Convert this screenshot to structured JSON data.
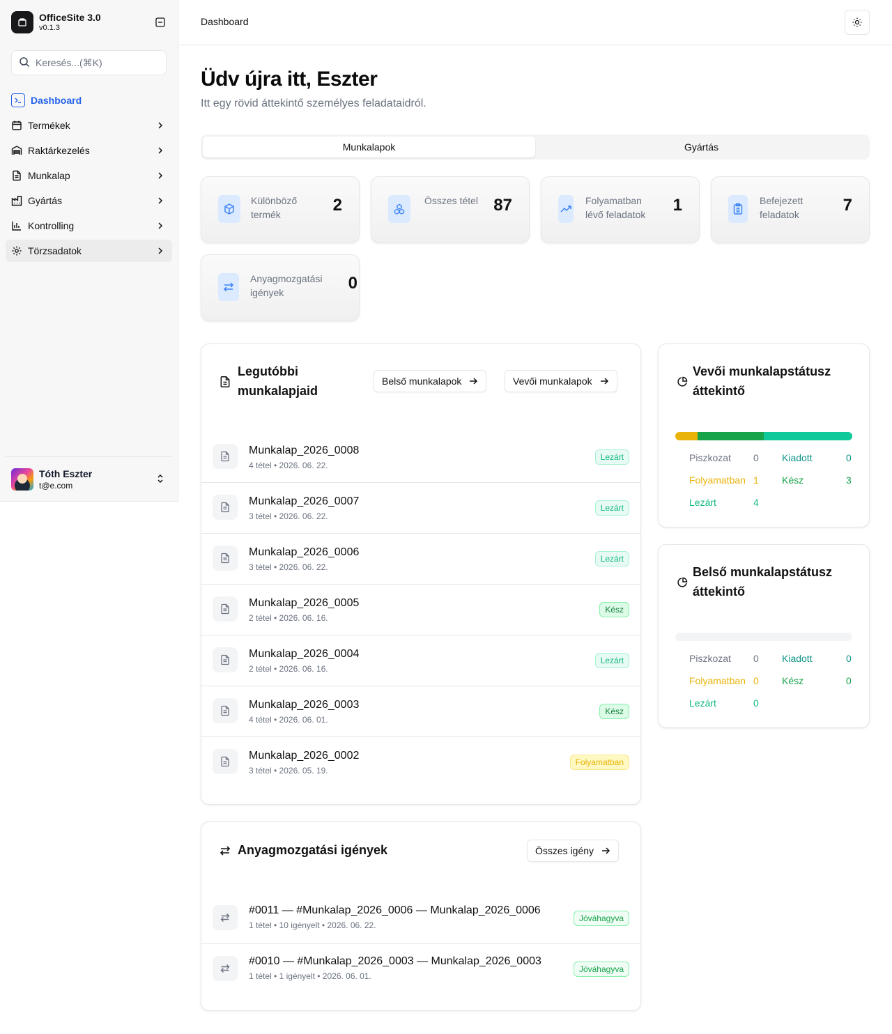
{
  "app": {
    "name": "OfficeSite 3.0",
    "version": "v0.1.3"
  },
  "search": {
    "placeholder": "Keresés...(⌘K)"
  },
  "nav": [
    {
      "label": "Dashboard",
      "icon": "terminal-square-icon"
    },
    {
      "label": "Termékek",
      "icon": "calendar-box-icon"
    },
    {
      "label": "Raktárkezelés",
      "icon": "warehouse-icon"
    },
    {
      "label": "Munkalap",
      "icon": "file-text-icon"
    },
    {
      "label": "Gyártás",
      "icon": "factory-icon"
    },
    {
      "label": "Kontrolling",
      "icon": "bar-chart-icon"
    },
    {
      "label": "Törzsadatok",
      "icon": "gear-icon"
    }
  ],
  "user": {
    "name": "Tóth Eszter",
    "email": "t@e.com"
  },
  "breadcrumb": "Dashboard",
  "page": {
    "title": "Üdv újra itt, Eszter",
    "subtitle": "Itt egy rövid áttekintő személyes feladataidról."
  },
  "tabs": [
    {
      "label": "Munkalapok"
    },
    {
      "label": "Gyártás"
    }
  ],
  "stats": [
    {
      "label": "Különböző termék",
      "value": "2",
      "icon": "box-icon"
    },
    {
      "label": "Összes tétel",
      "value": "87",
      "icon": "boxes-icon"
    },
    {
      "label": "Folyamatban lévő feladatok",
      "value": "1",
      "icon": "trending-up-icon"
    },
    {
      "label": "Befejezett feladatok",
      "value": "7",
      "icon": "clipboard-list-icon"
    },
    {
      "label": "Anyagmozgatási igények",
      "value": "0",
      "icon": "arrows-left-right-icon"
    }
  ],
  "recent": {
    "title": "Legutóbbi munkalapjaid",
    "btn_internal": "Belső munkalapok",
    "btn_customer": "Vevői munkalapok",
    "rows": [
      {
        "title": "Munkalap_2026_0008",
        "sub": "4 tétel • 2026. 06. 22.",
        "status": "Lezárt",
        "cls": "b-lezart"
      },
      {
        "title": "Munkalap_2026_0007",
        "sub": "3 tétel • 2026. 06. 22.",
        "status": "Lezárt",
        "cls": "b-lezart"
      },
      {
        "title": "Munkalap_2026_0006",
        "sub": "3 tétel • 2026. 06. 22.",
        "status": "Lezárt",
        "cls": "b-lezart"
      },
      {
        "title": "Munkalap_2026_0005",
        "sub": "2 tétel • 2026. 06. 16.",
        "status": "Kész",
        "cls": "b-kesz"
      },
      {
        "title": "Munkalap_2026_0004",
        "sub": "2 tétel • 2026. 06. 16.",
        "status": "Lezárt",
        "cls": "b-lezart"
      },
      {
        "title": "Munkalap_2026_0003",
        "sub": "4 tétel • 2026. 06. 01.",
        "status": "Kész",
        "cls": "b-kesz"
      },
      {
        "title": "Munkalap_2026_0002",
        "sub": "3 tétel • 2026. 05. 19.",
        "status": "Folyamatban",
        "cls": "b-folyamat"
      }
    ]
  },
  "moves": {
    "title": "Anyagmozgatási igények",
    "btn_all": "Összes igény",
    "rows": [
      {
        "title": "#0011 — #Munkalap_2026_0006 — Munkalap_2026_0006",
        "sub": "1 tétel • 10 igényelt • 2026. 06. 22.",
        "status": "Jóváhagyva"
      },
      {
        "title": "#0010 — #Munkalap_2026_0003 — Munkalap_2026_0003",
        "sub": "1 tétel • 1 igényelt • 2026. 06. 01.",
        "status": "Jóváhagyva"
      }
    ]
  },
  "status_colors": {
    "Piszkozat": "#6b7280",
    "Kiadott": "#0d9488",
    "Folyamatban": "#eab308",
    "Kész": "#16a34a",
    "Lezárt": "#10b981"
  },
  "customer_status": {
    "title": "Vevői munkalapstátusz áttekintő",
    "counts": {
      "Piszkozat": "0",
      "Kiadott": "0",
      "Folyamatban": "1",
      "Kész": "3",
      "Lezárt": "4"
    }
  },
  "internal_status": {
    "title": "Belső munkalapstátusz áttekintő",
    "counts": {
      "Piszkozat": "0",
      "Kiadott": "0",
      "Folyamatban": "0",
      "Kész": "0",
      "Lezárt": "0"
    }
  }
}
